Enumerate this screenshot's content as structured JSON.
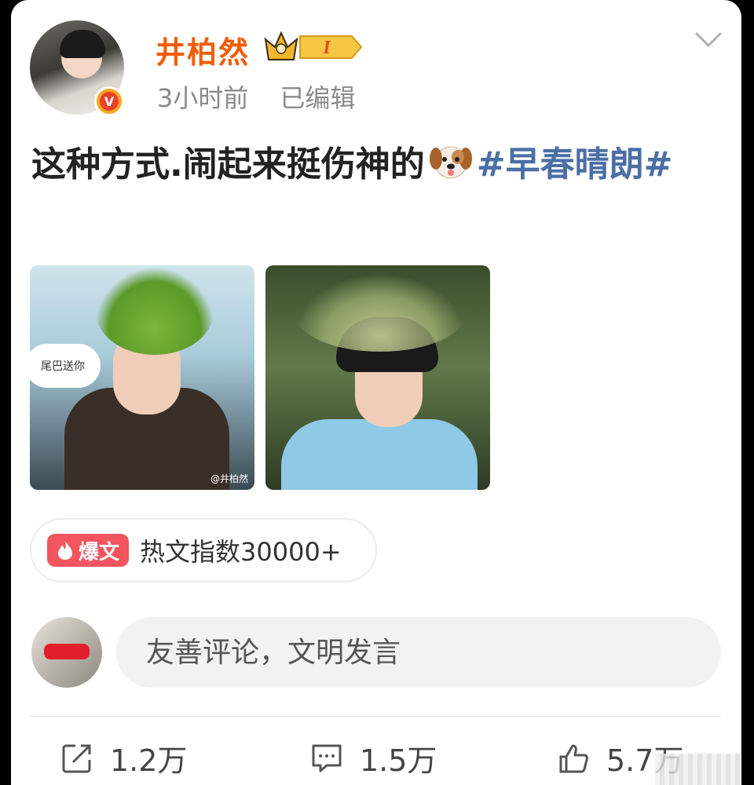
{
  "user": {
    "name": "井柏然",
    "level_badge": "I",
    "time": "3小时前",
    "edited": "已编辑",
    "verified_mark": "V"
  },
  "post": {
    "text": "这种方式.闹起来挺伤神的",
    "emoji": "dog-face-emoji",
    "hashtag": "#早春晴朗#"
  },
  "photos": {
    "photo1_caption": "尾巴送你",
    "photo1_watermark": "@井柏然"
  },
  "hot": {
    "badge": "爆文",
    "text": "热文指数30000+"
  },
  "comment": {
    "placeholder": "友善评论，文明发言"
  },
  "actions": {
    "repost_count": "1.2万",
    "comment_count": "1.5万",
    "like_count": "5.7万"
  },
  "colors": {
    "username": "#f25c05",
    "hashtag": "#4a6fa5",
    "hot_badge": "#f2555e"
  }
}
